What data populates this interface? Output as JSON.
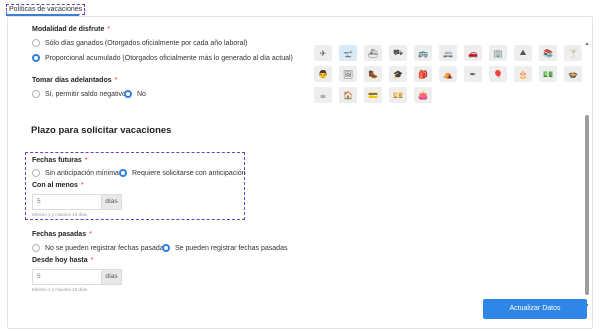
{
  "tab": {
    "label": "Políticas de vacaciones"
  },
  "modalidad": {
    "label": "Modalidad de disfrute",
    "required": "*",
    "options": [
      {
        "label": "Sólo días ganados (Otorgados oficialmente por cada año laboral)",
        "selected": false
      },
      {
        "label": "Proporcional acumulado (Otorgados oficialmente más lo generado al día actual)",
        "selected": true
      }
    ]
  },
  "adelantados": {
    "label": "Tomar días adelantados",
    "required": "*",
    "options": [
      {
        "label": "Sí, permitir saldo negativo",
        "selected": false
      },
      {
        "label": "No",
        "selected": true
      }
    ]
  },
  "plazo": {
    "title": "Plazo para solicitar vacaciones"
  },
  "futuras": {
    "label": "Fechas futuras",
    "required": "*",
    "options": [
      {
        "label": "Sin anticipación mínima",
        "selected": false
      },
      {
        "label": "Requiere solicitarse con anticipación",
        "selected": true
      }
    ],
    "min_label": "Con al menos",
    "min_required": "*",
    "value": "5",
    "unit": "días",
    "hint": "Mínimo 1 y máximo 15 días"
  },
  "pasadas": {
    "label": "Fechas pasadas",
    "required": "*",
    "options": [
      {
        "label": "No se pueden registrar fechas pasadas",
        "selected": false
      },
      {
        "label": "Se pueden registrar fechas pasadas",
        "selected": true
      }
    ],
    "desde_label": "Desde hoy hasta",
    "desde_required": "*",
    "value": "5",
    "unit": "días",
    "hint": "Mínimo 1 y máximo 15 días"
  },
  "icons": {
    "selected_index": 1,
    "items": [
      {
        "name": "airplane-icon",
        "glyph": "✈"
      },
      {
        "name": "plane-takeoff-icon",
        "glyph": "🛫"
      },
      {
        "name": "ship-icon",
        "glyph": "⛴"
      },
      {
        "name": "truck-icon",
        "glyph": "⛟"
      },
      {
        "name": "bus-icon",
        "glyph": "🚌"
      },
      {
        "name": "van-icon",
        "glyph": "🚐"
      },
      {
        "name": "car-icon",
        "glyph": "🚗"
      },
      {
        "name": "building-icon",
        "glyph": "🏢"
      },
      {
        "name": "mountain-icon",
        "glyph": "⛰"
      },
      {
        "name": "books-icon",
        "glyph": "📚"
      },
      {
        "name": "cocktail-icon",
        "glyph": "🍸"
      },
      {
        "name": "chef-hat-icon",
        "glyph": "👨"
      },
      {
        "name": "easel-icon",
        "glyph": "🖼"
      },
      {
        "name": "hiking-icon",
        "glyph": "🥾"
      },
      {
        "name": "graduation-cap-icon",
        "glyph": "🎓"
      },
      {
        "name": "backpack-icon",
        "glyph": "🎒"
      },
      {
        "name": "tent-icon",
        "glyph": "⛺"
      },
      {
        "name": "feather-icon",
        "glyph": "✒"
      },
      {
        "name": "balloon-icon",
        "glyph": "🎈"
      },
      {
        "name": "cake-icon",
        "glyph": "🎂"
      },
      {
        "name": "money-icon",
        "glyph": "💵"
      },
      {
        "name": "food-bowl-icon",
        "glyph": "🍲"
      },
      {
        "name": "coffee-icon",
        "glyph": "☕"
      },
      {
        "name": "home-icon",
        "glyph": "🏠"
      },
      {
        "name": "card-icon",
        "glyph": "💳"
      },
      {
        "name": "cash-icon",
        "glyph": "💴"
      },
      {
        "name": "wallet-icon",
        "glyph": "👛"
      }
    ]
  },
  "update_button": {
    "label": "Actualizar Datos"
  },
  "colors": {
    "accent": "#2f86e6",
    "required": "#e0352b",
    "radio_on": "#2f7fe0"
  }
}
